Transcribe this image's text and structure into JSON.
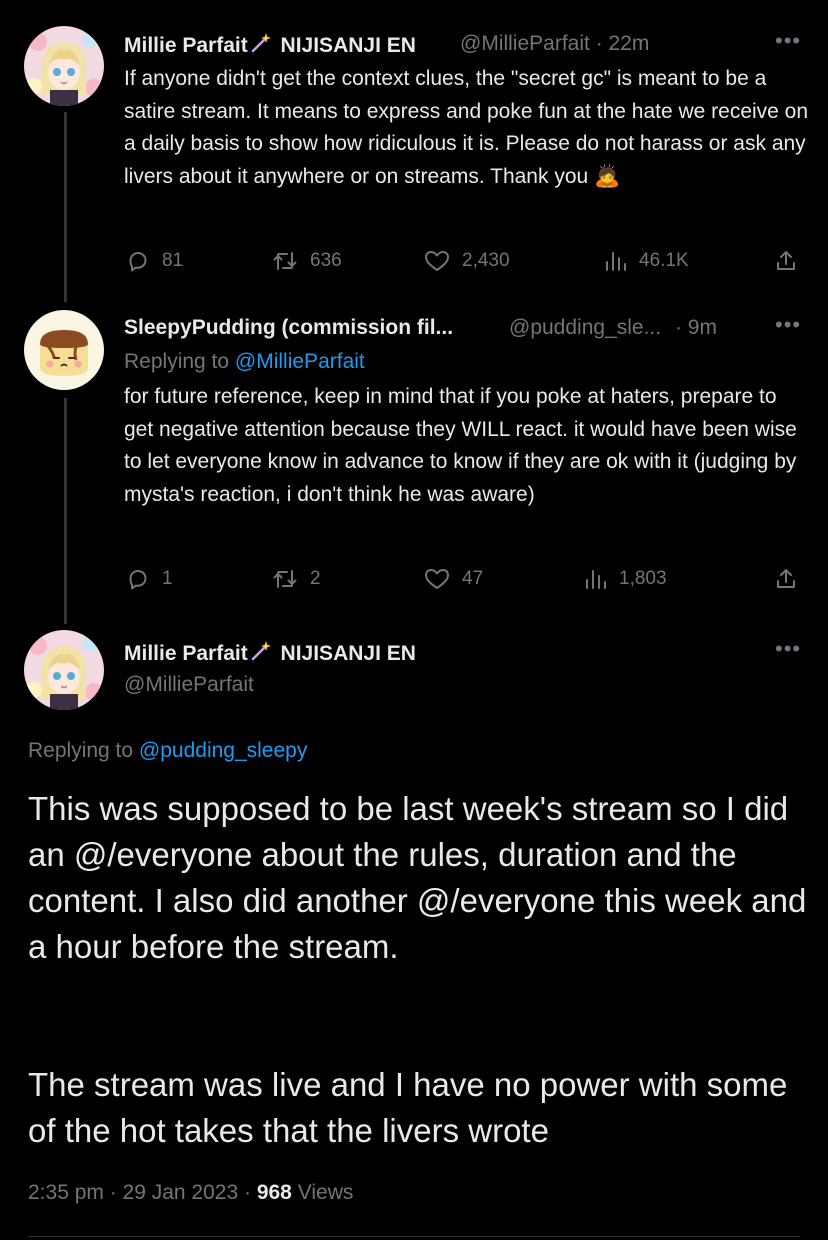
{
  "tweets": [
    {
      "name": "Millie Parfait",
      "name_suffix": "NIJISANJI EN",
      "handle": "@MillieParfait",
      "time": "· 22m",
      "text": "If anyone didn't get the context clues, the \"secret gc\" is meant to be a satire stream. It means to express and poke fun at the hate we receive on a daily basis to show how ridiculous it is. Please do not harass or ask any livers about it anywhere or on streams. Thank you 🙇",
      "replies": "81",
      "retweets": "636",
      "likes": "2,430",
      "views": "46.1K"
    },
    {
      "name": "SleepyPudding (commission fil...",
      "handle": "@pudding_sle...",
      "time": "· 9m",
      "replying_prefix": "Replying to",
      "replying_to": "@MillieParfait",
      "text": "for future reference, keep in mind that if you poke at haters, prepare to get negative attention because they WILL react. it would have been wise to let everyone know in advance to know if they are ok with it (judging by mysta's reaction, i don't think he was aware)",
      "replies": "1",
      "retweets": "2",
      "likes": "47",
      "views": "1,803"
    }
  ],
  "main_tweet": {
    "name": "Millie Parfait",
    "name_suffix": "NIJISANJI EN",
    "handle": "@MillieParfait",
    "replying_prefix": "Replying to",
    "replying_to": "@pudding_sleepy",
    "paragraph1": "This was supposed to be last week's stream so I did an @/everyone about the rules, duration and the content. I also did another @/everyone this week and a hour before the stream.",
    "paragraph2": "The stream was live and I have no power with some of the hot takes that the livers wrote",
    "timestamp": "2:35 pm · 29 Jan 2023 ·",
    "views_count": "968",
    "views_label": "Views"
  },
  "colors": {
    "background": "#000000",
    "text": "#e7e9ea",
    "muted": "#71767b",
    "link": "#1d9bf0"
  },
  "icons": [
    "wand-icon",
    "reply-icon",
    "retweet-icon",
    "like-icon",
    "views-icon",
    "share-icon",
    "more-icon",
    "bow-emoji"
  ]
}
